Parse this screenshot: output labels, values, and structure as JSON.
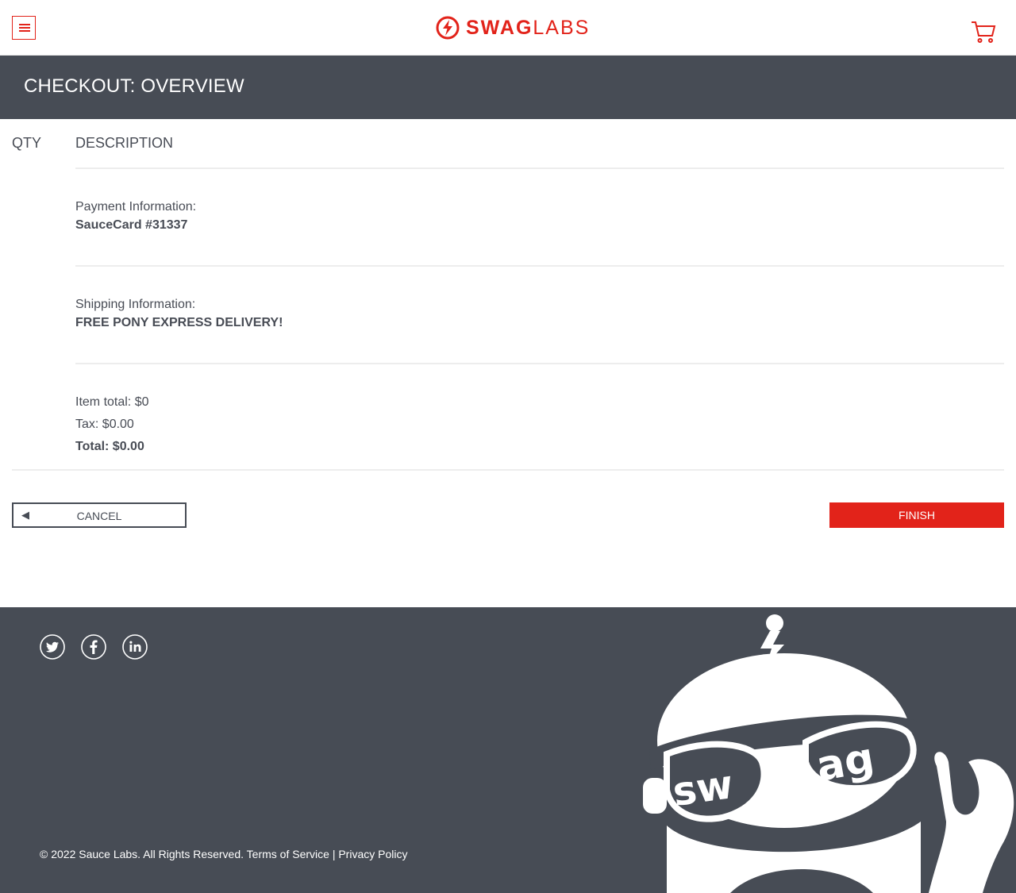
{
  "header": {
    "logo_text_bold": "SWAG",
    "logo_text_light": "LABS"
  },
  "subheader": {
    "title": "CHECKOUT: OVERVIEW"
  },
  "cart_list": {
    "qty_label": "QTY",
    "description_label": "DESCRIPTION"
  },
  "summary": {
    "payment_label": "Payment Information:",
    "payment_value": "SauceCard #31337",
    "shipping_label": "Shipping Information:",
    "shipping_value": "FREE PONY EXPRESS DELIVERY!",
    "item_total": "Item total: $0",
    "tax": "Tax: $0.00",
    "total": "Total: $0.00"
  },
  "actions": {
    "cancel_arrow": "◀",
    "cancel_label": "CANCEL",
    "finish_label": "FINISH"
  },
  "footer": {
    "copyright": "© 2022 Sauce Labs. All Rights Reserved.",
    "terms_link": "Terms of Service",
    "separator": "|",
    "privacy_link": "Privacy Policy",
    "robot_text": "swag",
    "social": [
      "twitter-icon",
      "facebook-icon",
      "linkedin-icon"
    ]
  },
  "colors": {
    "brand_red": "#e2231a",
    "dark_gray": "#474c55",
    "text": "#484c55"
  }
}
